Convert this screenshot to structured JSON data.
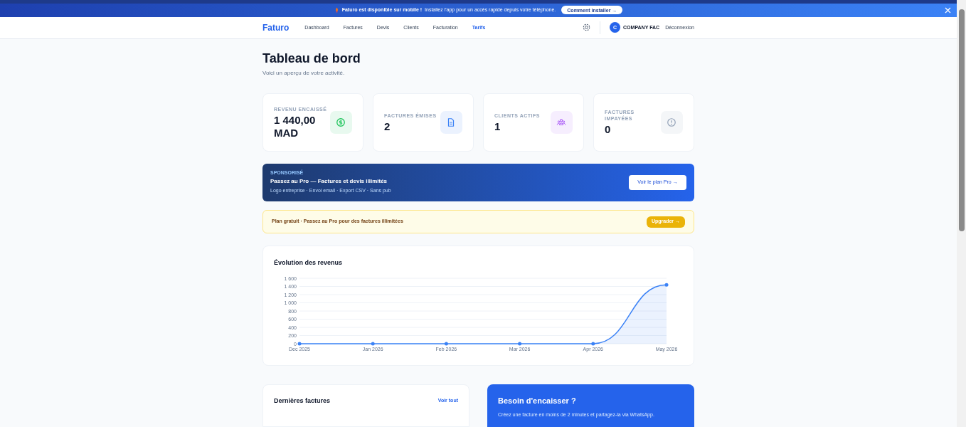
{
  "banner": {
    "headline": "Faturo est disponible sur mobile !",
    "text": "Installez l'app pour un accès rapide depuis votre téléphone.",
    "button": "Comment installer →"
  },
  "nav": {
    "brand": "Faturo",
    "items": [
      {
        "label": "Dashboard",
        "selected": false
      },
      {
        "label": "Factures",
        "selected": false
      },
      {
        "label": "Devis",
        "selected": false
      },
      {
        "label": "Clients",
        "selected": false
      },
      {
        "label": "Facturation",
        "selected": false
      },
      {
        "label": "Tarifs",
        "selected": true
      }
    ],
    "avatar": "C",
    "company": "COMPANY FAC",
    "logout": "Déconnexion"
  },
  "page": {
    "title": "Tableau de bord",
    "subtitle": "Voici un aperçu de votre activité."
  },
  "stats": [
    {
      "label": "REVENU ENCAISSÉ",
      "value": "1 440,00 MAD",
      "kind": "money",
      "color": "#22c55e"
    },
    {
      "label": "FACTURES ÉMISES",
      "value": "2",
      "kind": "document",
      "color": "#3b82f6"
    },
    {
      "label": "CLIENTS ACTIFS",
      "value": "1",
      "kind": "users",
      "color": "#a855f7"
    },
    {
      "label": "FACTURES IMPAYÉES",
      "value": "0",
      "kind": "alert",
      "color": "#94a3b8"
    }
  ],
  "sponsor": {
    "tag": "SPONSORISÉ",
    "title": "Passez au Pro — Factures et devis illimités",
    "features": "Logo entreprise · Envoi email · Export CSV · Sans pub",
    "button": "Voir le plan Pro →"
  },
  "plan_notice": {
    "text": "Plan gratuit · Passez au Pro pour des factures illimitées",
    "button": "Upgrader →"
  },
  "revenue": {
    "title": "Évolution des revenus",
    "chart_data": {
      "type": "area",
      "categories": [
        "Dec 2025",
        "Jan 2026",
        "Feb 2026",
        "Mar 2026",
        "Apr 2026",
        "May 2026"
      ],
      "series": [
        {
          "color": "#3b82f6",
          "values": [
            0,
            0,
            0,
            0,
            0,
            1440
          ]
        }
      ],
      "grid": true,
      "ylim": [
        0,
        1600
      ],
      "yticks": [
        0,
        200,
        400,
        600,
        800,
        {
          "value": 1000,
          "label": "1 000"
        },
        {
          "value": 1200,
          "label": "1 200"
        },
        {
          "value": 1400,
          "label": "1 400"
        },
        {
          "value": 1600,
          "label": "1 600"
        }
      ]
    }
  },
  "recent_invoices": {
    "title": "Dernières factures",
    "link": "Voir tout"
  },
  "promo": {
    "title": "Besoin d'encaisser ?",
    "text": "Créez une facture en moins de 2 minutes et partagez-la via WhatsApp."
  }
}
